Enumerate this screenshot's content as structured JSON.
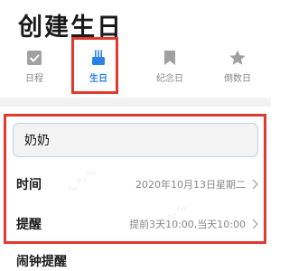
{
  "page": {
    "title": "创建生日"
  },
  "tabs": [
    {
      "label": "日程",
      "icon": "calendar-check-icon",
      "active": false
    },
    {
      "label": "生日",
      "icon": "birthday-cake-icon",
      "active": true
    },
    {
      "label": "纪念日",
      "icon": "bookmark-icon",
      "active": false
    },
    {
      "label": "倒数日",
      "icon": "star-icon",
      "active": false
    }
  ],
  "form": {
    "name_value": "奶奶",
    "time": {
      "label": "时间",
      "value": "2020年10月13日星期二"
    },
    "reminder": {
      "label": "提醒",
      "value": "提前3天10:00,当天10:00"
    },
    "alarm": {
      "label": "闹钟提醒"
    }
  },
  "colors": {
    "accent": "#2a82e4",
    "highlight": "#e03a2f",
    "muted_icon": "#9a9a9a"
  }
}
